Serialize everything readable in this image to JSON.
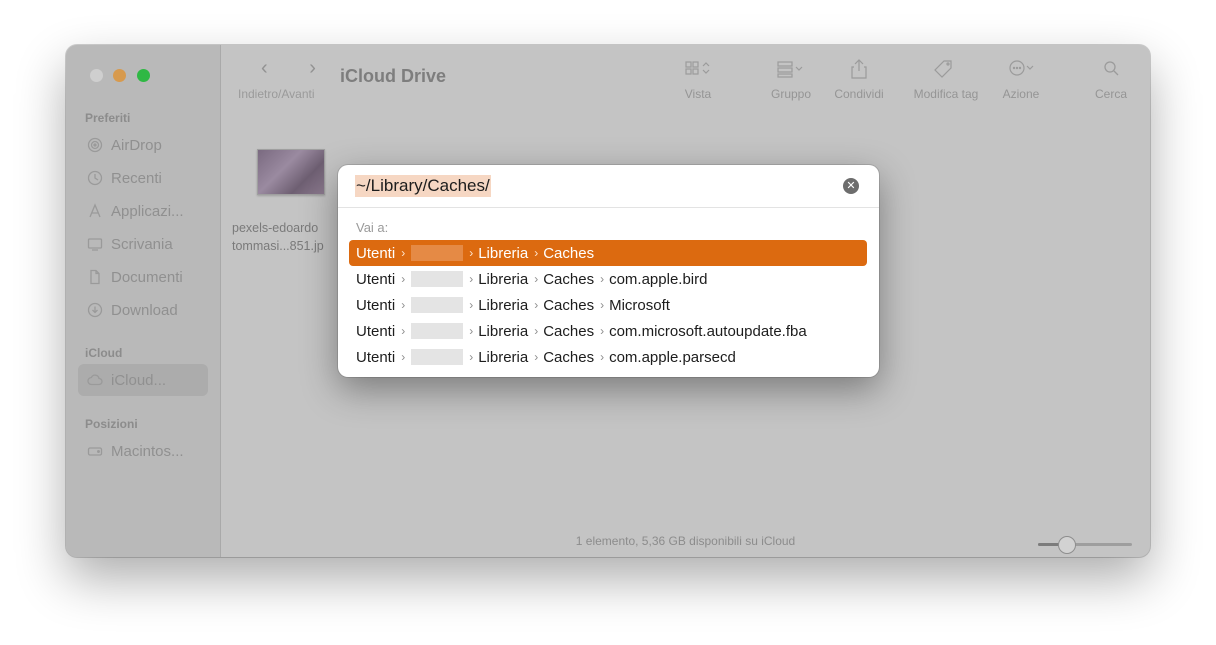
{
  "sidebar": {
    "sections": {
      "favorites": "Preferiti",
      "icloud": "iCloud",
      "locations": "Posizioni"
    },
    "favorites": [
      {
        "label": "AirDrop",
        "icon": "airdrop-icon"
      },
      {
        "label": "Recenti",
        "icon": "clock-icon"
      },
      {
        "label": "Applicazi...",
        "icon": "applications-icon"
      },
      {
        "label": "Scrivania",
        "icon": "desktop-icon"
      },
      {
        "label": "Documenti",
        "icon": "document-icon"
      },
      {
        "label": "Download",
        "icon": "download-icon"
      }
    ],
    "icloud_item": {
      "label": "iCloud...",
      "icon": "cloud-icon"
    },
    "locations_item": {
      "label": "Macintos...",
      "icon": "disk-icon"
    }
  },
  "toolbar": {
    "nav_arrows": "‹ ›",
    "nav_caption": "Indietro/Avanti",
    "title": "iCloud Drive",
    "buttons": {
      "view": "Vista",
      "group": "Gruppo",
      "share": "Condividi",
      "tags": "Modifica tag",
      "action": "Azione",
      "search": "Cerca"
    }
  },
  "file": {
    "line1": "pexels-edoardo",
    "line2": "tommasi...851.jp"
  },
  "status": {
    "text": "1 elemento, 5,36 GB disponibili su iCloud",
    "zoom_fraction": 0.25
  },
  "goto": {
    "path": "~/Library/Caches/",
    "label": "Vai a:",
    "rows": [
      {
        "p1": "Utenti",
        "p2": "Libreria",
        "p3": "Caches",
        "p4": ""
      },
      {
        "p1": "Utenti",
        "p2": "Libreria",
        "p3": "Caches",
        "p4": "com.apple.bird"
      },
      {
        "p1": "Utenti",
        "p2": "Libreria",
        "p3": "Caches",
        "p4": "Microsoft"
      },
      {
        "p1": "Utenti",
        "p2": "Libreria",
        "p3": "Caches",
        "p4": "com.microsoft.autoupdate.fba"
      },
      {
        "p1": "Utenti",
        "p2": "Libreria",
        "p3": "Caches",
        "p4": "com.apple.parsecd"
      }
    ]
  },
  "colors": {
    "accent": "#dc6a10",
    "traffic_min": "#d79a4e",
    "traffic_max": "#2fb844"
  }
}
